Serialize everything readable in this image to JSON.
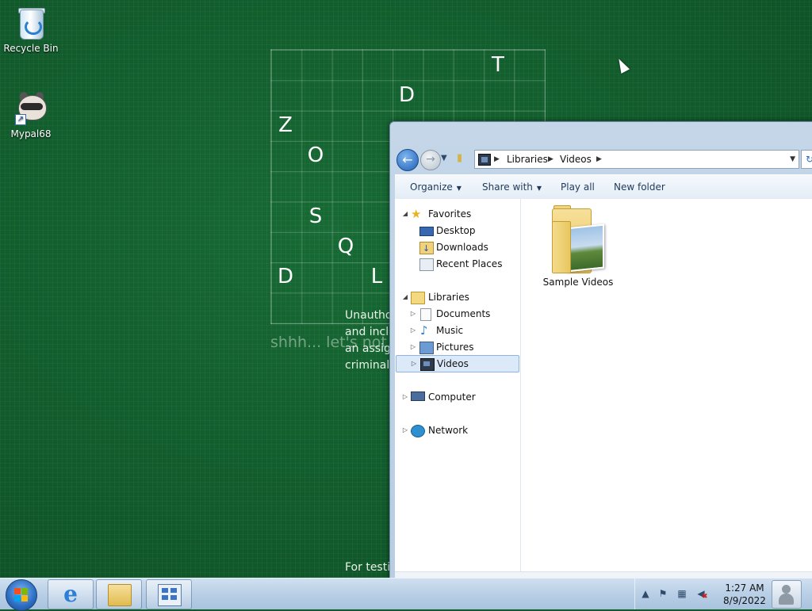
{
  "desktop": {
    "icons": [
      {
        "label": "Recycle Bin",
        "icon": "recycle-bin-icon"
      },
      {
        "label": "Mypal68",
        "icon": "raccoon-icon"
      }
    ],
    "puzzle_letters": [
      "T",
      "D",
      "Z",
      "O",
      "S",
      "Q",
      "D",
      "L"
    ],
    "puzzle_hint": "shhh... let's not",
    "side_text": [
      "Unautho",
      "and incl",
      "an assig",
      "criminal"
    ],
    "bottom_text": "For testi"
  },
  "explorer": {
    "address": {
      "segments": [
        "Libraries",
        "Videos"
      ]
    },
    "toolbar": {
      "organize": "Organize",
      "share_with": "Share with",
      "play_all": "Play all",
      "new_folder": "New folder"
    },
    "nav": {
      "favorites": "Favorites",
      "desktop": "Desktop",
      "downloads": "Downloads",
      "recent_places": "Recent Places",
      "libraries": "Libraries",
      "documents": "Documents",
      "music": "Music",
      "pictures": "Pictures",
      "videos": "Videos",
      "computer": "Computer",
      "network": "Network"
    },
    "content": {
      "items": [
        {
          "label": "Sample Videos",
          "icon": "video-folder-icon"
        }
      ]
    }
  },
  "taskbar": {
    "time": "1:27 AM",
    "date": "8/9/2022",
    "pinned": [
      "internet-explorer-icon",
      "windows-explorer-icon",
      "control-panel-icon"
    ]
  },
  "colors": {
    "wallpaper": "#13612f",
    "selection": "#dbe9f9",
    "taskbar": "#b9cfe6"
  }
}
